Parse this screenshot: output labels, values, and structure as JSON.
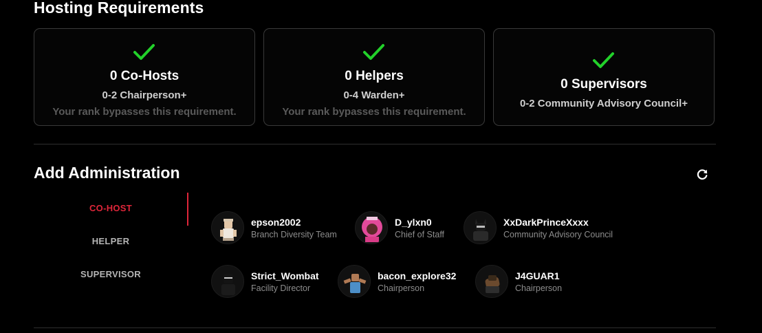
{
  "hosting": {
    "title": "Hosting Requirements",
    "cards": [
      {
        "title": "0 Co-Hosts",
        "range": "0-2 Chairperson+",
        "note": "Your rank bypasses this requirement."
      },
      {
        "title": "0 Helpers",
        "range": "0-4 Warden+",
        "note": "Your rank bypasses this requirement."
      },
      {
        "title": "0 Supervisors",
        "range": "0-2 Community Advisory Council+"
      }
    ],
    "check_icon": "check-icon",
    "check_color": "#22d12a"
  },
  "admin": {
    "title": "Add Administration",
    "refresh_icon": "refresh-icon",
    "tabs": [
      {
        "label": "CO-HOST",
        "active": true
      },
      {
        "label": "HELPER",
        "active": false
      },
      {
        "label": "SUPERVISOR",
        "active": false
      }
    ],
    "accent_color": "#e0263a",
    "users": [
      {
        "name": "epson2002",
        "role": "Branch Diversity Team"
      },
      {
        "name": "D_ylxn0",
        "role": "Chief of Staff"
      },
      {
        "name": "XxDarkPrinceXxxx",
        "role": "Community Advisory Council"
      },
      {
        "name": "Strict_Wombat",
        "role": "Facility Director"
      },
      {
        "name": "bacon_explore32",
        "role": "Chairperson"
      },
      {
        "name": "J4GUAR1",
        "role": "Chairperson"
      }
    ]
  }
}
